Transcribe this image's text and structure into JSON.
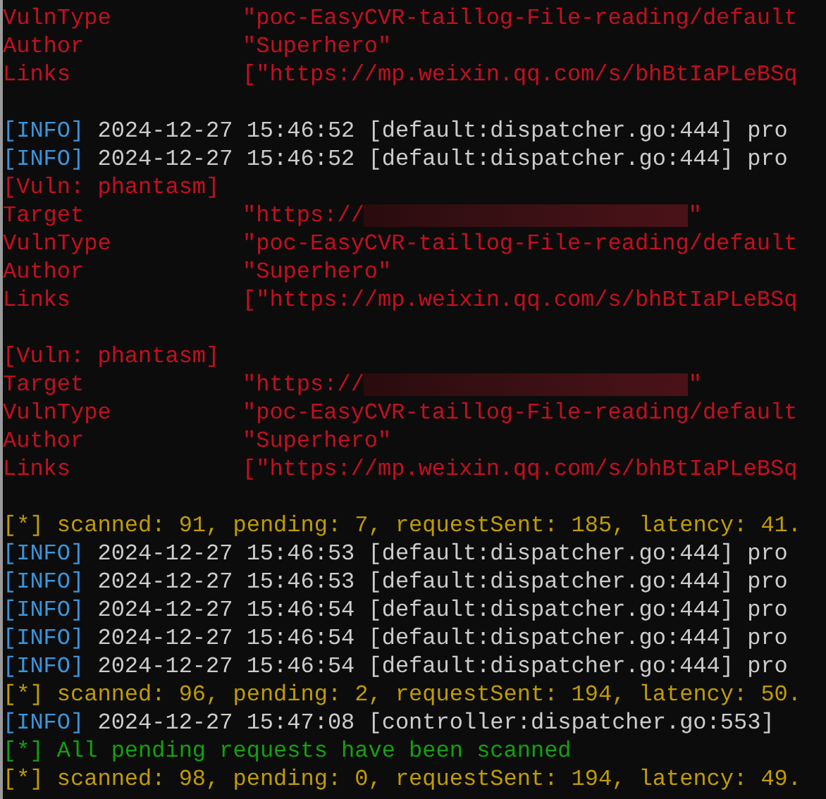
{
  "terminal": {
    "lines": [
      {
        "kind": "field",
        "key": "VulnType",
        "value": "\"poc-EasyCVR-taillog-File-reading/default"
      },
      {
        "kind": "field",
        "key": "Author",
        "value": "\"Superhero\""
      },
      {
        "kind": "field",
        "key": "Links",
        "value": "[\"https://mp.weixin.qq.com/s/bhBtIaPLeBSq"
      },
      {
        "kind": "blank"
      },
      {
        "kind": "info",
        "tag": "[INFO]",
        "text": "2024-12-27 15:46:52 [default:dispatcher.go:444] pro"
      },
      {
        "kind": "info",
        "tag": "[INFO]",
        "text": "2024-12-27 15:46:52 [default:dispatcher.go:444] pro"
      },
      {
        "kind": "header",
        "text": "[Vuln: phantasm]"
      },
      {
        "kind": "redacted_field",
        "key": "Target",
        "value": "\"https://",
        "suffix": "\""
      },
      {
        "kind": "field",
        "key": "VulnType",
        "value": "\"poc-EasyCVR-taillog-File-reading/default"
      },
      {
        "kind": "field",
        "key": "Author",
        "value": "\"Superhero\""
      },
      {
        "kind": "field",
        "key": "Links",
        "value": "[\"https://mp.weixin.qq.com/s/bhBtIaPLeBSq"
      },
      {
        "kind": "blank"
      },
      {
        "kind": "header",
        "text": "[Vuln: phantasm]"
      },
      {
        "kind": "redacted_field",
        "key": "Target",
        "value": "\"https://",
        "suffix": "\""
      },
      {
        "kind": "field",
        "key": "VulnType",
        "value": "\"poc-EasyCVR-taillog-File-reading/default"
      },
      {
        "kind": "field",
        "key": "Author",
        "value": "\"Superhero\""
      },
      {
        "kind": "field",
        "key": "Links",
        "value": "[\"https://mp.weixin.qq.com/s/bhBtIaPLeBSq"
      },
      {
        "kind": "blank"
      },
      {
        "kind": "progress",
        "tag": "[*]",
        "text": "scanned: 91, pending: 7, requestSent: 185, latency: 41."
      },
      {
        "kind": "info",
        "tag": "[INFO]",
        "text": "2024-12-27 15:46:53 [default:dispatcher.go:444] pro"
      },
      {
        "kind": "info",
        "tag": "[INFO]",
        "text": "2024-12-27 15:46:53 [default:dispatcher.go:444] pro"
      },
      {
        "kind": "info",
        "tag": "[INFO]",
        "text": "2024-12-27 15:46:54 [default:dispatcher.go:444] pro"
      },
      {
        "kind": "info",
        "tag": "[INFO]",
        "text": "2024-12-27 15:46:54 [default:dispatcher.go:444] pro"
      },
      {
        "kind": "info",
        "tag": "[INFO]",
        "text": "2024-12-27 15:46:54 [default:dispatcher.go:444] pro"
      },
      {
        "kind": "progress",
        "tag": "[*]",
        "text": "scanned: 96, pending: 2, requestSent: 194, latency: 50."
      },
      {
        "kind": "info",
        "tag": "[INFO]",
        "text": "2024-12-27 15:47:08 [controller:dispatcher.go:553]"
      },
      {
        "kind": "success",
        "tag": "[*]",
        "text": "All pending requests have been scanned"
      },
      {
        "kind": "progress",
        "tag": "[*]",
        "text": "scanned: 98, pending: 0, requestSent: 194, latency: 49."
      }
    ]
  }
}
